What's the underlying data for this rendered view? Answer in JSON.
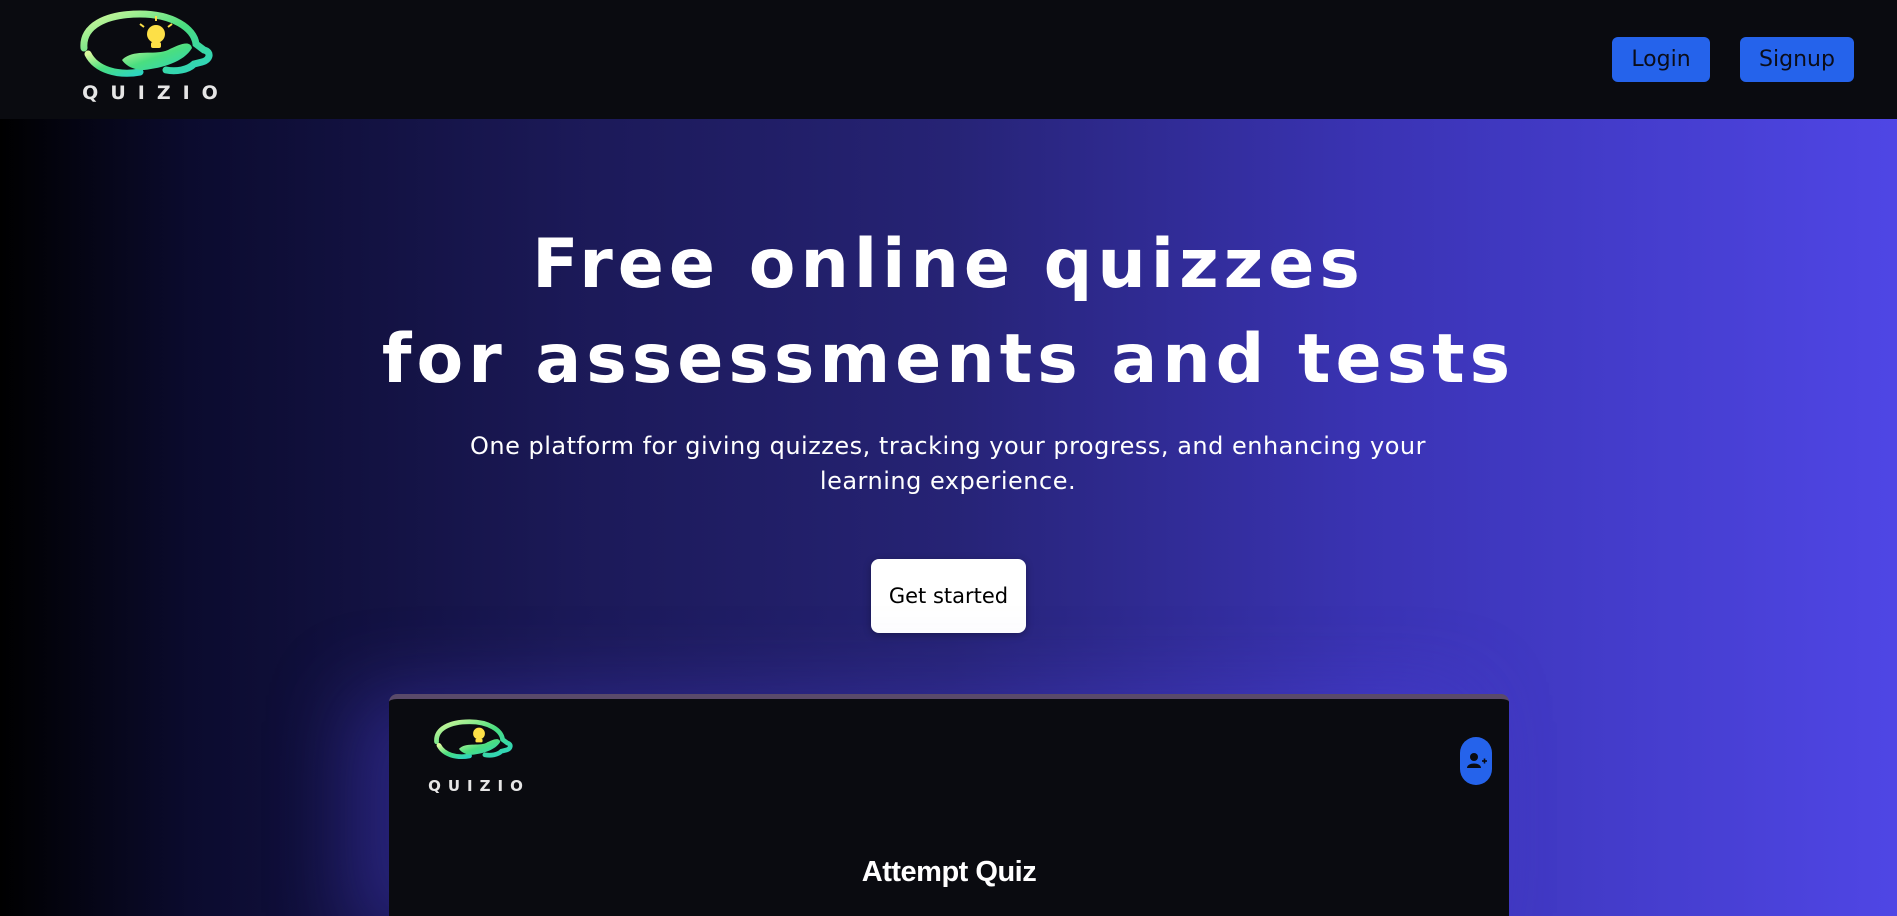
{
  "navbar": {
    "logo_text": "QUIZIO",
    "login_label": "Login",
    "signup_label": "Signup"
  },
  "hero": {
    "title_line1": "Free online quizzes",
    "title_line2": "for assessments and tests",
    "subtitle": "One platform for giving quizzes, tracking your progress, and enhancing your learning experience.",
    "cta_label": "Get started"
  },
  "preview": {
    "logo_text": "QUIZIO",
    "heading": "Attempt Quiz",
    "avatar_icon": "add-user-icon"
  },
  "colors": {
    "nav_bg": "#0a0b10",
    "button": "#2563eb",
    "gradient_end": "#4f46e5",
    "logo_green": "#4ade80"
  }
}
